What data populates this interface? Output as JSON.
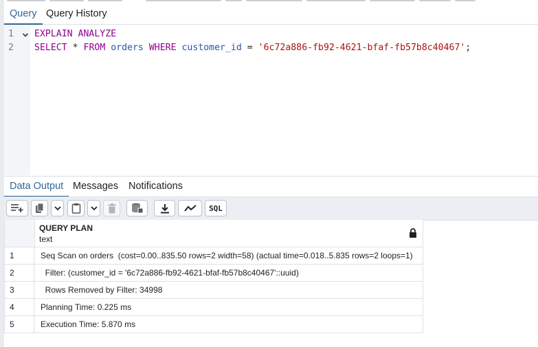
{
  "editor_tabs": [
    {
      "label": "Query",
      "active": true
    },
    {
      "label": "Query History",
      "active": false
    }
  ],
  "editor": {
    "line_numbers": [
      "1",
      "2"
    ],
    "line1": {
      "kw1": "EXPLAIN",
      "kw2": "ANALYZE"
    },
    "line2": {
      "kw_select": "SELECT",
      "star": "*",
      "kw_from": "FROM",
      "table": "orders",
      "kw_where": "WHERE",
      "column": "customer_id",
      "eq": "=",
      "value": "'6c72a886-fb92-4621-bfaf-fb57b8c40467'",
      "semicolon": ";"
    }
  },
  "output_tabs": [
    {
      "label": "Data Output",
      "active": true
    },
    {
      "label": "Messages",
      "active": false
    },
    {
      "label": "Notifications",
      "active": false
    }
  ],
  "toolbar": {
    "icons": [
      "add-row-icon",
      "copy-icon",
      "chevron-down-icon",
      "paste-icon",
      "chevron-down-icon",
      "delete-icon",
      "save-data-icon",
      "download-icon",
      "graph-icon",
      "sql-icon"
    ],
    "sql_label": "SQL"
  },
  "grid": {
    "column": {
      "name": "QUERY PLAN",
      "type": "text"
    },
    "rows": [
      {
        "num": "1",
        "value": "Seq Scan on orders  (cost=0.00..835.50 rows=2 width=58) (actual time=0.018..5.835 rows=2 loops=1)"
      },
      {
        "num": "2",
        "value": "  Filter: (customer_id = '6c72a886-fb92-4621-bfaf-fb57b8c40467'::uuid)"
      },
      {
        "num": "3",
        "value": "  Rows Removed by Filter: 34998"
      },
      {
        "num": "4",
        "value": "Planning Time: 0.225 ms"
      },
      {
        "num": "5",
        "value": "Execution Time: 5.870 ms"
      }
    ]
  },
  "colors": {
    "accent": "#326690",
    "keyword": "#900090",
    "identifier": "#2456a8",
    "string": "#aa1111"
  }
}
